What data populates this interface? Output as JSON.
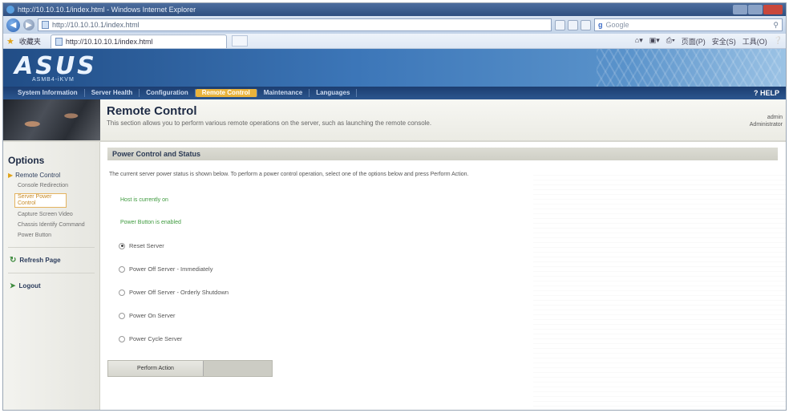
{
  "browser": {
    "window_title": "http://10.10.10.1/index.html - Windows Internet Explorer",
    "address": "http://10.10.10.1/index.html",
    "search_placeholder": "Google",
    "favorites_label": "收藏夹",
    "tab_title": "http://10.10.10.1/index.html",
    "tools": [
      "页面(P)",
      "安全(S)",
      "工具(O)"
    ]
  },
  "brand": {
    "logo": "ASUS",
    "subtitle": "ASMB4-iKVM"
  },
  "menu": {
    "items": [
      {
        "label": "System Information"
      },
      {
        "label": "Server Health"
      },
      {
        "label": "Configuration"
      },
      {
        "label": "Remote Control"
      },
      {
        "label": "Maintenance"
      },
      {
        "label": "Languages"
      }
    ],
    "help": "HELP"
  },
  "header": {
    "title": "Remote Control",
    "description": "This section allows you to perform various remote operations on the server, such as launching the remote console.",
    "user_name": "admin",
    "user_role": "Administrator"
  },
  "sidebar": {
    "title": "Options",
    "group": "Remote Control",
    "subitems": [
      {
        "label": "Console Redirection"
      },
      {
        "label": "Server Power Control"
      },
      {
        "label": "Capture Screen Video"
      },
      {
        "label": "Chassis Identify Command"
      },
      {
        "label": "Power Button"
      }
    ],
    "refresh": "Refresh Page",
    "logout": "Logout"
  },
  "main": {
    "section_title": "Power Control and Status",
    "intro": "The current server power status is shown below. To perform a power control operation, select one of the options below and press Perform Action.",
    "status": "Host is currently on",
    "power_button_status": "Power Button is enabled",
    "options": [
      {
        "label": "Reset Server",
        "selected": true
      },
      {
        "label": "Power Off Server - Immediately",
        "selected": false
      },
      {
        "label": "Power Off Server - Orderly Shutdown",
        "selected": false
      },
      {
        "label": "Power On Server",
        "selected": false
      },
      {
        "label": "Power Cycle Server",
        "selected": false
      }
    ],
    "perform_label": "Perform Action"
  }
}
